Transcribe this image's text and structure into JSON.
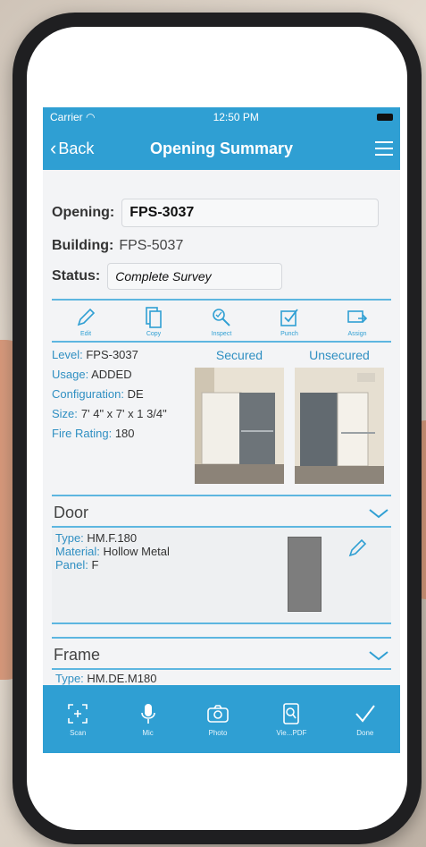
{
  "status_bar": {
    "carrier": "Carrier",
    "time": "12:50 PM"
  },
  "nav": {
    "back_label": "Back",
    "title": "Opening Summary"
  },
  "opening": {
    "label": "Opening:",
    "value": "FPS-3037"
  },
  "building": {
    "label": "Building:",
    "value": "FPS-5037"
  },
  "status": {
    "label": "Status:",
    "value": "Complete Survey"
  },
  "toolbar": [
    {
      "icon": "pencil-icon",
      "label": "Edit"
    },
    {
      "icon": "copy-icon",
      "label": "Copy"
    },
    {
      "icon": "inspect-icon",
      "label": "Inspect"
    },
    {
      "icon": "punch-icon",
      "label": "Punch"
    },
    {
      "icon": "assign-icon",
      "label": "Assign"
    }
  ],
  "info": {
    "level": {
      "label": "Level:",
      "value": "FPS-3037"
    },
    "usage": {
      "label": "Usage:",
      "value": "ADDED"
    },
    "configuration": {
      "label": "Configuration:",
      "value": "DE"
    },
    "size": {
      "label": "Size:",
      "value": "7' 4\" x 7' x 1 3/4\""
    },
    "fire_rating": {
      "label": "Fire Rating:",
      "value": "180"
    }
  },
  "photos": {
    "secured": "Secured",
    "unsecured": "Unsecured"
  },
  "door": {
    "title": "Door",
    "type": {
      "label": "Type:",
      "value": "HM.F.180"
    },
    "material": {
      "label": "Material:",
      "value": "Hollow Metal"
    },
    "panel": {
      "label": "Panel:",
      "value": "F"
    }
  },
  "frame": {
    "title": "Frame",
    "type": {
      "label": "Type:",
      "value": "HM.DE.M180"
    }
  },
  "tabbar": [
    {
      "icon": "scan-icon",
      "label": "Scan"
    },
    {
      "icon": "mic-icon",
      "label": "Mic"
    },
    {
      "icon": "camera-icon",
      "label": "Photo"
    },
    {
      "icon": "pdf-icon",
      "label": "Vie...PDF"
    },
    {
      "icon": "check-icon",
      "label": "Done"
    }
  ],
  "colors": {
    "accent": "#2f9fd3",
    "label_blue": "#2f8fc2"
  }
}
